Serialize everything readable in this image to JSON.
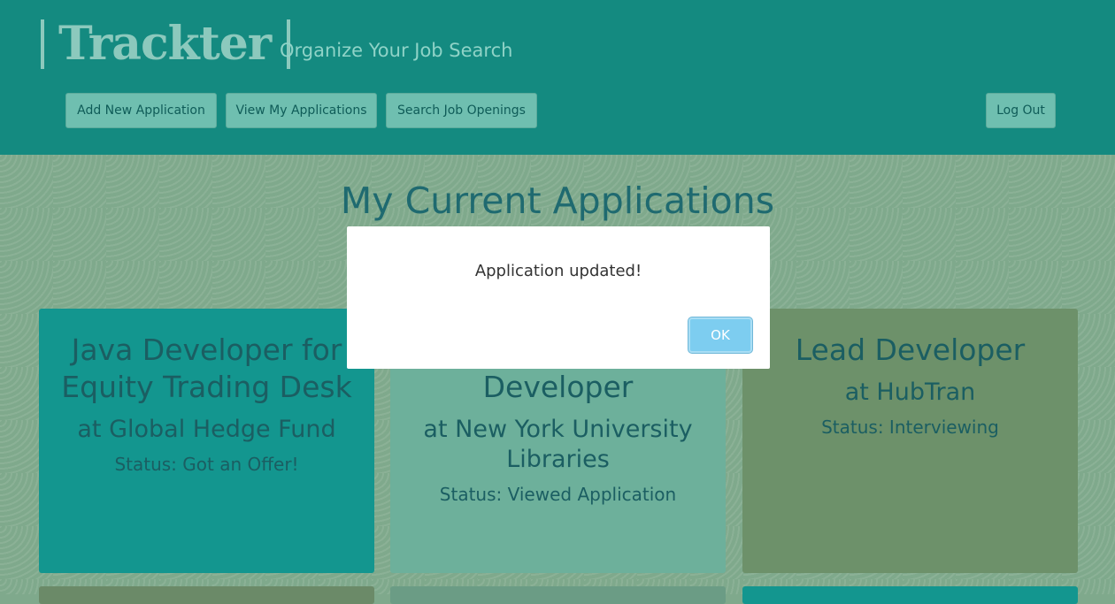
{
  "header": {
    "brand": "Trackter",
    "tagline": "Organize Your Job Search",
    "nav": {
      "add": "Add New Application",
      "view": "View My Applications",
      "search": "Search Job Openings",
      "logout": "Log Out"
    }
  },
  "main": {
    "title": "My Current Applications",
    "cards": [
      {
        "title": "Java Developer for Equity Trading Desk",
        "company": "at Global Hedge Fund",
        "status": "Status: Got an Offer!"
      },
      {
        "title": "Developer",
        "company": "at New York University Libraries",
        "status": "Status: Viewed Application"
      },
      {
        "title": "Lead Developer",
        "company": "at HubTran",
        "status": "Status: Interviewing"
      }
    ]
  },
  "modal": {
    "message": "Application updated!",
    "ok_label": "OK"
  },
  "colors": {
    "header_bg": "#148a80",
    "card_offer": "#13968f",
    "card_viewed": "#6db09b",
    "card_interviewing": "#6d916a",
    "ok_button": "#7dcdf0"
  }
}
